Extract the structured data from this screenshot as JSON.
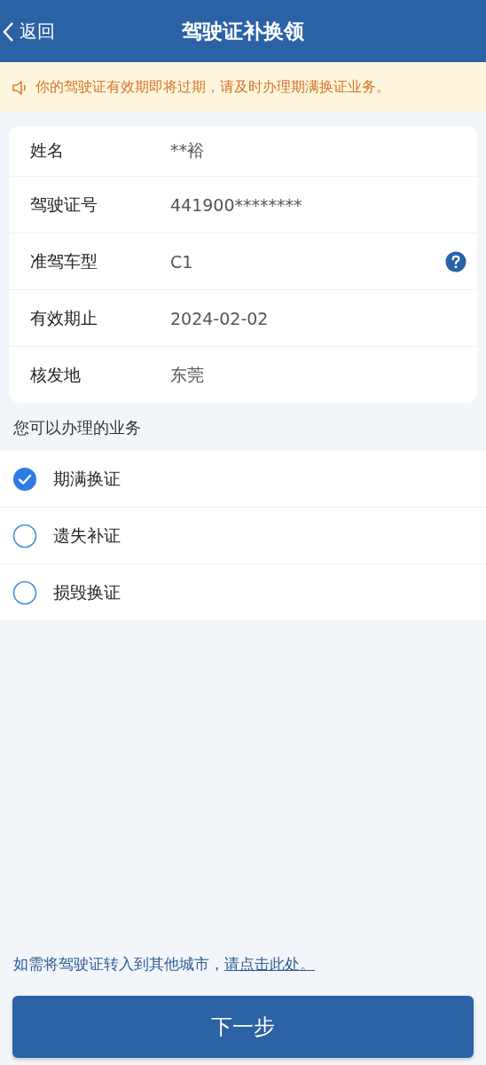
{
  "header": {
    "back": "返回",
    "title": "驾驶证补换领"
  },
  "notice": "你的驾驶证有效期即将过期，请及时办理期满换证业务。",
  "info_rows": [
    {
      "label": "姓名",
      "value": "**裕",
      "has_help": false
    },
    {
      "label": "驾驶证号",
      "value": "441900********",
      "has_help": false
    },
    {
      "label": "准驾车型",
      "value": "C1",
      "has_help": true
    },
    {
      "label": "有效期止",
      "value": "2024-02-02",
      "has_help": false
    },
    {
      "label": "核发地",
      "value": "东莞",
      "has_help": false
    }
  ],
  "section_title": "您可以办理的业务",
  "options": [
    {
      "label": "期满换证",
      "selected": true
    },
    {
      "label": "遗失补证",
      "selected": false
    },
    {
      "label": "损毁换证",
      "selected": false
    }
  ],
  "transfer_note": {
    "text": "如需将驾驶证转入到其他城市，",
    "link": "请点击此处。"
  },
  "next_button": "下一步"
}
